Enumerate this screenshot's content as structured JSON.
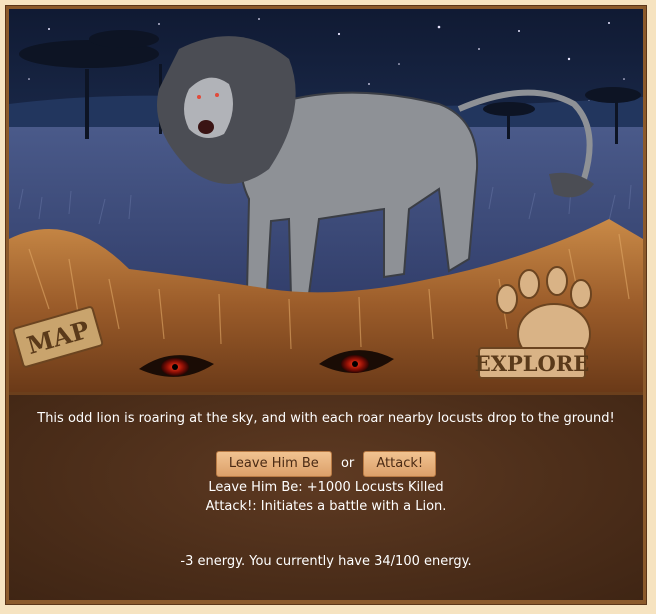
{
  "scene": {
    "map_label": "MAP",
    "explore_label": "EXPLORE"
  },
  "encounter": {
    "description": "This odd lion is roaring at the sky, and with each roar nearby locusts drop to the ground!",
    "choice_1_label": "Leave Him Be",
    "separator": "or",
    "choice_2_label": "Attack!",
    "choice_1_result": "Leave Him Be: +1000 Locusts Killed",
    "choice_2_result": "Attack!: Initiates a battle with a Lion.",
    "energy_text": "-3 energy. You currently have 34/100 energy."
  },
  "colors": {
    "page_bg": "#f6e3c0",
    "panel_bg": "#4b2d19",
    "button_bg": "#e8b27c",
    "night_sky": "#1c2a4a"
  }
}
